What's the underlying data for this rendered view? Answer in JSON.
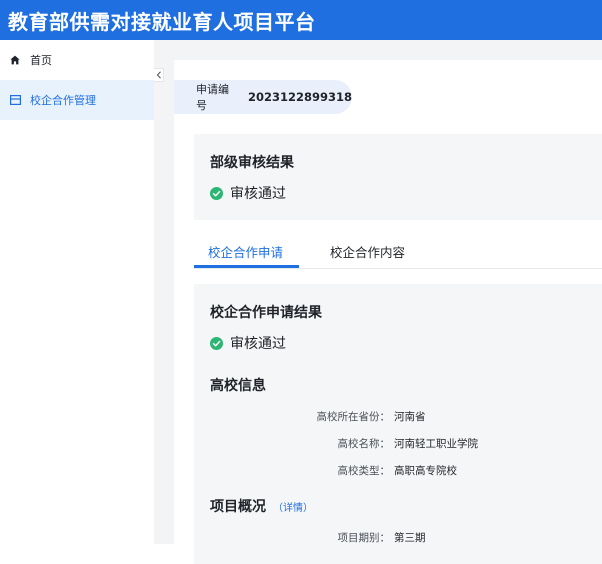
{
  "header": {
    "title": "教育部供需对接就业育人项目平台"
  },
  "sidebar": {
    "items": [
      {
        "label": "首页",
        "icon": "home-icon",
        "active": false
      },
      {
        "label": "校企合作管理",
        "icon": "list-icon",
        "active": true
      }
    ],
    "collapse_icon": "‹"
  },
  "application": {
    "number_label": "申请编号",
    "number_value": "2023122899318"
  },
  "ministry_review": {
    "title": "部级审核结果",
    "status": "审核通过"
  },
  "tabs": [
    {
      "label": "校企合作申请",
      "active": true
    },
    {
      "label": "校企合作内容",
      "active": false
    }
  ],
  "apply_result": {
    "title": "校企合作申请结果",
    "status": "审核通过",
    "school_info": {
      "title": "高校信息",
      "fields": [
        {
          "key": "高校所在省份：",
          "value": "河南省"
        },
        {
          "key": "高校名称：",
          "value": "河南轻工职业学院"
        },
        {
          "key": "高校类型：",
          "value": "高职高专院校"
        }
      ]
    },
    "project_overview": {
      "title": "项目概况",
      "detail_link": "（详情）",
      "fields": [
        {
          "key": "项目期别：",
          "value": "第三期"
        }
      ]
    }
  },
  "colors": {
    "primary": "#1f6fe0",
    "success": "#2bb673"
  }
}
